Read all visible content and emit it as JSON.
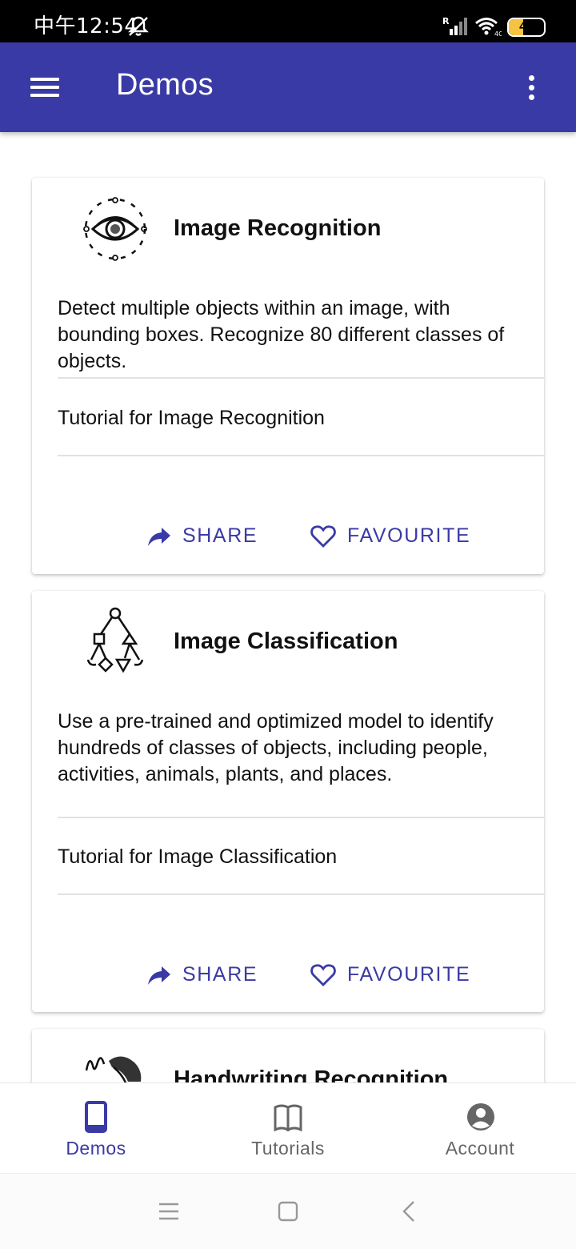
{
  "status_bar": {
    "time": "中午12:54",
    "battery": "42",
    "battery_level": 0.42,
    "icons": [
      "mute-icon",
      "signal-icon",
      "wifi-icon",
      "battery-icon"
    ]
  },
  "app_bar": {
    "title": "Demos",
    "icons": [
      "menu-icon",
      "more-vert-icon"
    ]
  },
  "cards": [
    {
      "icon": "eye-icon",
      "title": "Image Recognition",
      "description": "Detect multiple objects within an image, with bounding boxes. Recognize 80 different classes of objects.",
      "tutorial": "Tutorial for Image Recognition",
      "share_label": "SHARE",
      "favourite_label": "FAVOURITE"
    },
    {
      "icon": "classification-tree-icon",
      "title": "Image Classification",
      "description": "Use a pre-trained and optimized model to identify hundreds of classes of objects, including people, activities, animals, plants, and places.",
      "tutorial": "Tutorial for Image Classification",
      "share_label": "SHARE",
      "favourite_label": "FAVOURITE"
    },
    {
      "icon": "handwriting-icon",
      "title": "Handwriting Recognition"
    }
  ],
  "bottom_nav": {
    "items": [
      {
        "label": "Demos",
        "icon": "phone-icon",
        "active": true
      },
      {
        "label": "Tutorials",
        "icon": "book-icon",
        "active": false
      },
      {
        "label": "Account",
        "icon": "account-circle-icon",
        "active": false
      }
    ]
  },
  "colors": {
    "primary": "#3a3aa6",
    "inactive": "#666666",
    "battery": "#f5c242"
  }
}
